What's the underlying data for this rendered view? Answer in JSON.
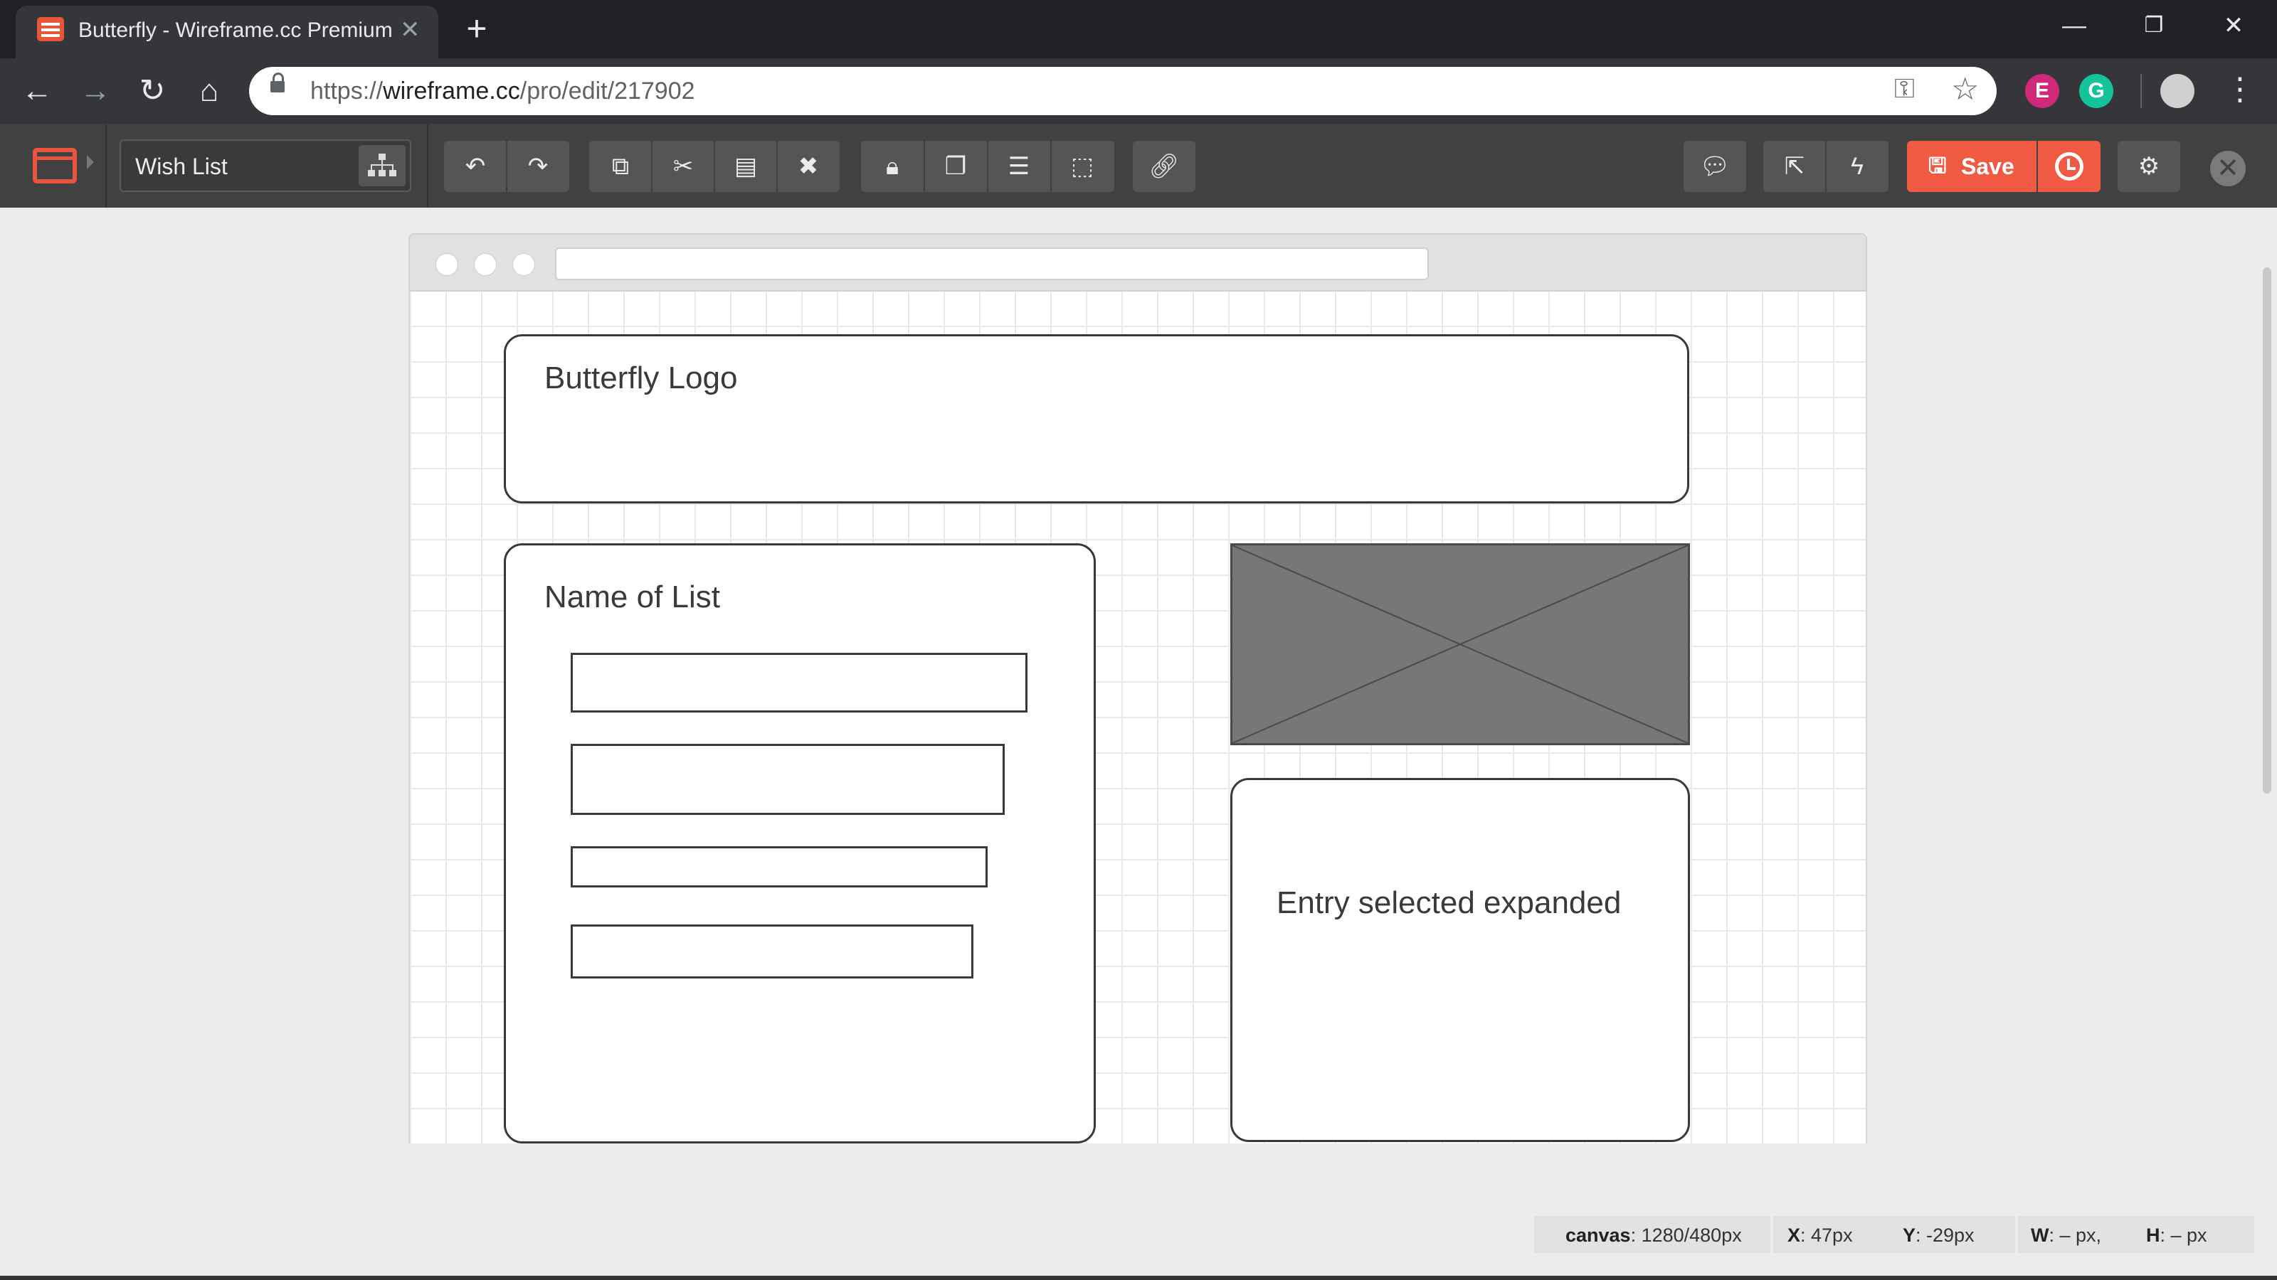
{
  "browser": {
    "tab_title": "Butterfly - Wireframe.cc Premium",
    "tab_close": "✕",
    "new_tab": "+",
    "url_scheme": "https://",
    "url_domain": "wireframe.cc",
    "url_path": "/pro/edit/217902",
    "window_controls": {
      "minimize": "—",
      "restore": "❐",
      "close": "✕"
    },
    "extensions": [
      {
        "name": "extension-e",
        "glyph": "E",
        "color": "#d0297a"
      },
      {
        "name": "grammarly",
        "glyph": "G",
        "color": "#15c39a"
      }
    ]
  },
  "toolbar": {
    "document_title": "Wish List",
    "save_label": "Save",
    "groups": [
      [
        "undo-icon",
        "redo-icon"
      ],
      [
        "duplicate-icon",
        "cut-icon",
        "paste-icon",
        "delete-icon"
      ],
      [
        "lock-icon",
        "arrange-icon",
        "align-icon",
        "group-icon"
      ],
      [
        "link-icon"
      ],
      [
        "comment-icon"
      ],
      [
        "preview-icon",
        "quick-icon"
      ]
    ],
    "colors": {
      "background": "#414141",
      "button": "#555555",
      "accent": "#f05a43"
    }
  },
  "wireframe": {
    "header_label": "Butterfly Logo",
    "list_title": "Name of List",
    "detail_label": "Entry selected expanded",
    "list_items_count": 4,
    "image_placeholder": "crossed-image-placeholder"
  },
  "status": {
    "canvas_key": "canvas",
    "canvas_val": ": 1280/480px",
    "x_key": "X",
    "x_val": ": 47px",
    "y_key": "Y",
    "y_val": ": -29px",
    "w_key": "W",
    "w_val": ": – px,",
    "h_key": "H",
    "h_val": ": – px"
  }
}
